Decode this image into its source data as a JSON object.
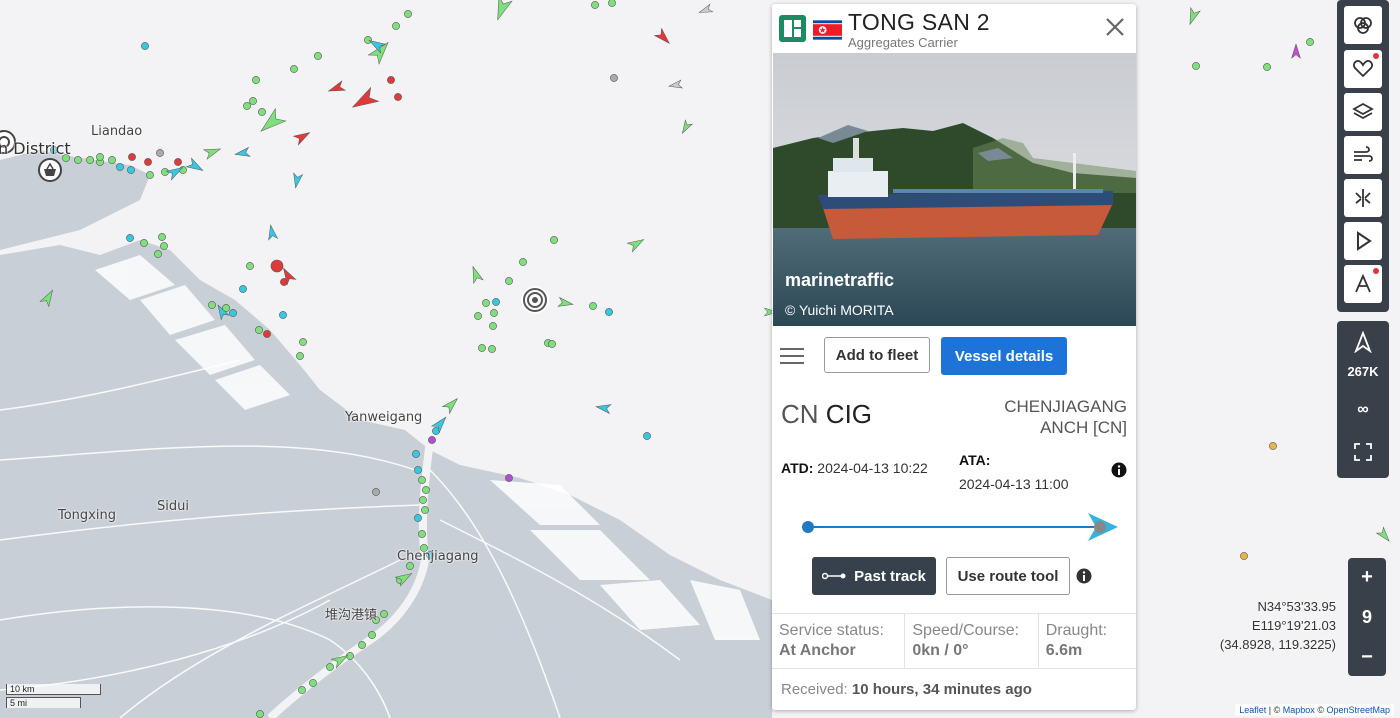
{
  "map": {
    "labels": {
      "liandao": "Liandao",
      "district": "n District",
      "yanweigang": "Yanweigang",
      "tongxing": "Tongxing",
      "sidui": "Sidui",
      "chenjiagang": "Chenjiagang",
      "duigou": "堆沟港镇"
    },
    "icons": {
      "port_icon": "basket-icon",
      "anchor_marker": "target-icon"
    }
  },
  "vessel_panel": {
    "name": "TONG SAN 2",
    "vessel_type": "Aggregates Carrier",
    "flag": "north-korea-flag",
    "photo_watermark": "marinetraffic",
    "photo_credit": "© Yuichi MORITA",
    "add_to_fleet_label": "Add to fleet",
    "vessel_details_label": "Vessel details",
    "destination_country": "CN",
    "destination_code": "CIG",
    "destination_name_line1": "CHENJIAGANG",
    "destination_name_line2": "ANCH [CN]",
    "atd_label": "ATD:",
    "atd_value": "2024-04-13 10:22",
    "ata_label": "ATA:",
    "ata_value": "2024-04-13 11:00",
    "route_progress": 1.0,
    "past_track_label": "Past track",
    "route_tool_label": "Use route tool",
    "service_status_label": "Service status:",
    "service_status_value": "At Anchor",
    "speed_course_label": "Speed/Course:",
    "speed_course_value": "0kn / 0°",
    "draught_label": "Draught:",
    "draught_value": "6.6m",
    "received_label": "Received:",
    "received_value": "10 hours, 34 minutes ago"
  },
  "toolbar": {
    "icons": [
      "filters-icon",
      "favorites-icon",
      "layers-icon",
      "wind-icon",
      "density-icon",
      "play-icon",
      "measure-icon"
    ],
    "vessel_count": "267K",
    "infinity_label": "∞",
    "fullscreen_icon": "fullscreen-icon"
  },
  "zoom": {
    "plus": "+",
    "level": "9",
    "minus": "−"
  },
  "coordinates": {
    "lat": "N34°53'33.95",
    "lon": "E119°19'21.03",
    "decimal": "(34.8928, 119.3225)"
  },
  "scale": {
    "km": "10 km",
    "mi": "5 mi"
  },
  "attribution": {
    "leaflet": "Leaflet",
    "sep1": " | © ",
    "mapbox": "Mapbox",
    "sep2": " © ",
    "osm": "OpenStreetMap"
  },
  "colors": {
    "land": "#c9cfd6",
    "sea": "#f3f3f5",
    "vessel_cargo": "#7ee07a",
    "vessel_tanker": "#e0393a",
    "vessel_passenger": "#38c7e0",
    "primary_button": "#1e73d8",
    "dark_button": "#37414d"
  }
}
